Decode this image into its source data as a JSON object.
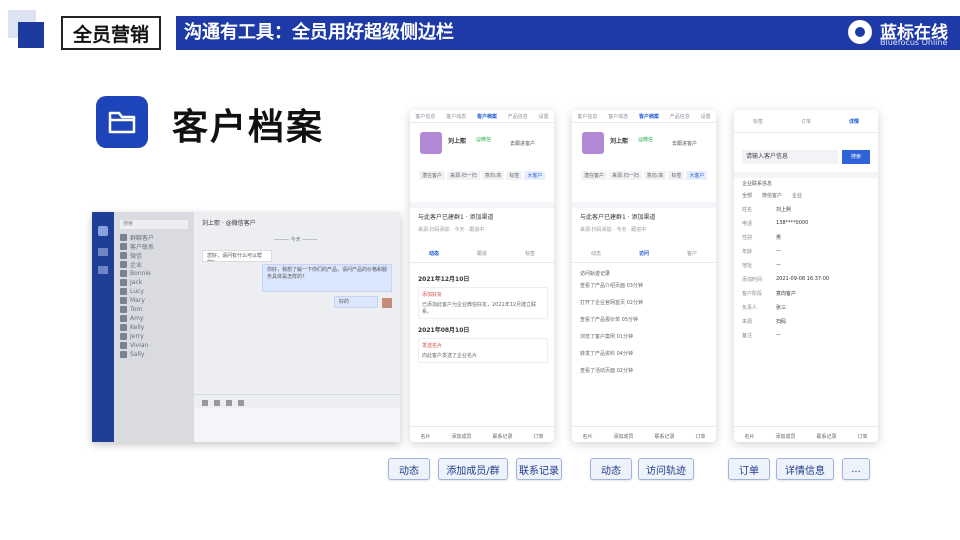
{
  "header": {
    "tag": "全员营销",
    "banner_title": "沟通有工具：全员用好超级侧边栏",
    "logo_name": "蓝标在线",
    "logo_sub": "Bluefocus Online"
  },
  "section": {
    "title": "客户档案",
    "icon": "folder-icon"
  },
  "desktop_chat": {
    "search": "搜索",
    "chat_title": "刘上熙 · @微信客户",
    "system_line": "——— 今天 ———",
    "sidebar_items": [
      "群聊客户",
      "客户联系",
      "微信",
      "企业",
      "Bonnie",
      "Jack",
      "Lucy",
      "Mary",
      "Tom",
      "Amy",
      "Kelly",
      "Jerry",
      "Vivian",
      "Sally"
    ],
    "messages": [
      {
        "text": "您好，请问有什么可以帮您？",
        "side": "left"
      },
      {
        "text": "你好，我想了解一下你们的产品，请问产品的价格和服务具体是怎样的？",
        "side": "right"
      },
      {
        "text": "好的",
        "side": "right"
      }
    ]
  },
  "phone1": {
    "tabs": [
      "客户信息",
      "客户动态",
      "客户档案",
      "产品信息",
      "设置"
    ],
    "name": "刘上熙",
    "badge": "@微信",
    "action": "去跟进客户",
    "chips": [
      "潜在客户",
      "来源:扫一扫",
      "意向:高",
      "标签",
      "大客户"
    ],
    "info_line1": "与此客户已建群1 · 添加渠道",
    "info_line2": "来源:扫码添加 · 今天 · 跟进中",
    "sub_tabs": [
      "动态",
      "跟进",
      "标签"
    ],
    "timeline": [
      {
        "date": "2021年12月10日"
      },
      {
        "label": "添加好友",
        "note": "已添加此客户为企业微信好友，2021年12月建立联系。"
      },
      {
        "date": "2021年08月10日"
      },
      {
        "label": "发送名片",
        "note": "向此客户发送了企业名片"
      }
    ],
    "bottom_nav": [
      "名片",
      "添加成员",
      "联系记录",
      "订单"
    ]
  },
  "phone2": {
    "tabs": [
      "客户信息",
      "客户动态",
      "客户档案",
      "产品信息",
      "设置"
    ],
    "name": "刘上熙",
    "badge": "@微信",
    "action": "去跟进客户",
    "chips": [
      "潜在客户",
      "来源:扫一扫",
      "意向:高",
      "标签",
      "大客户"
    ],
    "info_line1": "与此客户已建群1 · 添加渠道",
    "info_line2": "来源:扫码添加 · 今天 · 跟进中",
    "sub_tabs": [
      "动态",
      "访问",
      "客户"
    ],
    "records_title": "访问轨迹记录",
    "records": [
      "查看了产品介绍页面 03分钟",
      "打开了企业官网首页 02分钟",
      "查看了产品报价单 05分钟",
      "浏览了客户案例 01分钟",
      "转发了产品资料 04分钟",
      "查看了活动页面 02分钟"
    ],
    "bottom_nav": [
      "名片",
      "添加成员",
      "联系记录",
      "订单"
    ]
  },
  "phone3": {
    "tabs": [
      "标签",
      "订单",
      "详情"
    ],
    "search_placeholder": "请输入客户信息",
    "search_button": "搜索",
    "section_label": "企业联系信息",
    "filters": [
      "全部",
      "微信客户",
      "企业"
    ],
    "fields": [
      {
        "label": "姓名",
        "value": "刘上熙"
      },
      {
        "label": "电话",
        "value": "138****0000"
      },
      {
        "label": "性别",
        "value": "男"
      },
      {
        "label": "年龄",
        "value": "—"
      },
      {
        "label": "地址",
        "value": "—"
      },
      {
        "label": "添加时间",
        "value": "2021-09-08 16:37:00"
      },
      {
        "label": "客户阶段",
        "value": "意向客户"
      },
      {
        "label": "负责人",
        "value": "张三"
      },
      {
        "label": "来源",
        "value": "扫码"
      },
      {
        "label": "备注",
        "value": "—"
      }
    ],
    "bottom_nav": [
      "名片",
      "添加成员",
      "联系记录",
      "订单"
    ]
  },
  "feature_buttons": [
    "动态",
    "添加成员/群",
    "联系记录",
    "动态",
    "访问轨迹",
    "订单",
    "详情信息",
    "..."
  ],
  "colors": {
    "brand": "#1e3aa6",
    "accent": "#1d44b8",
    "text": "#111111"
  }
}
